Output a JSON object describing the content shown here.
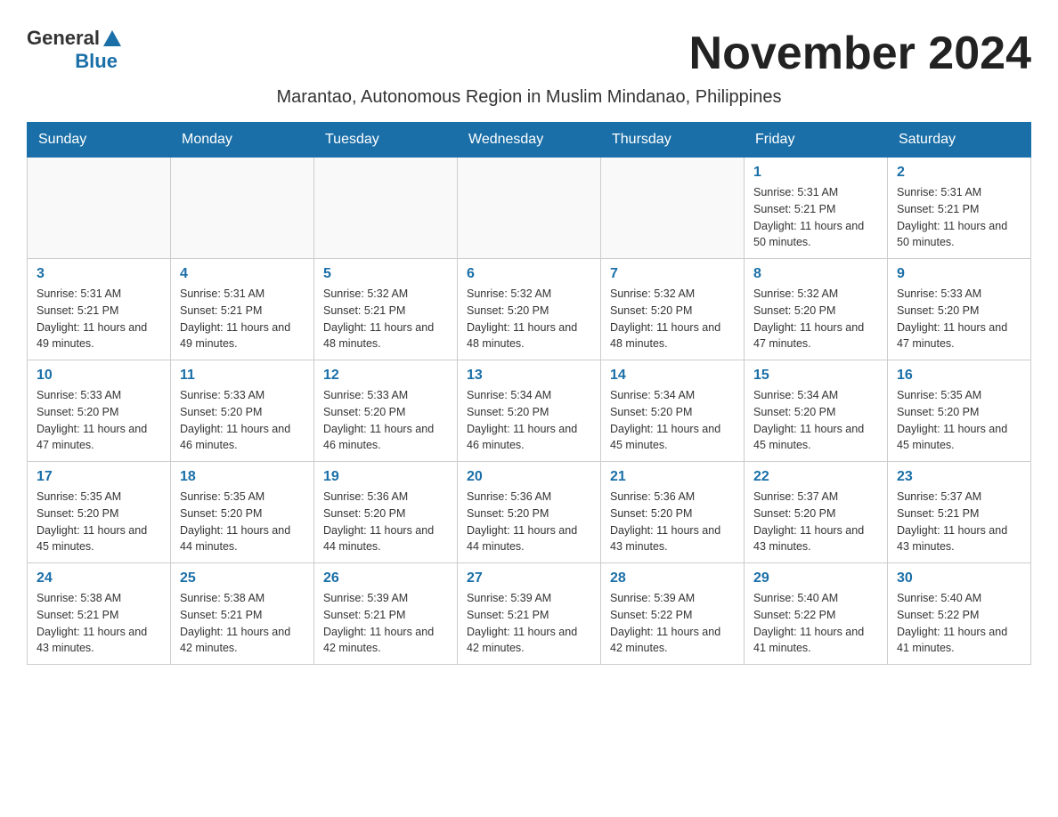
{
  "logo": {
    "general": "General",
    "blue": "Blue"
  },
  "title": "November 2024",
  "subtitle": "Marantao, Autonomous Region in Muslim Mindanao, Philippines",
  "days_of_week": [
    "Sunday",
    "Monday",
    "Tuesday",
    "Wednesday",
    "Thursday",
    "Friday",
    "Saturday"
  ],
  "weeks": [
    [
      {
        "day": "",
        "info": ""
      },
      {
        "day": "",
        "info": ""
      },
      {
        "day": "",
        "info": ""
      },
      {
        "day": "",
        "info": ""
      },
      {
        "day": "",
        "info": ""
      },
      {
        "day": "1",
        "info": "Sunrise: 5:31 AM\nSunset: 5:21 PM\nDaylight: 11 hours and 50 minutes."
      },
      {
        "day": "2",
        "info": "Sunrise: 5:31 AM\nSunset: 5:21 PM\nDaylight: 11 hours and 50 minutes."
      }
    ],
    [
      {
        "day": "3",
        "info": "Sunrise: 5:31 AM\nSunset: 5:21 PM\nDaylight: 11 hours and 49 minutes."
      },
      {
        "day": "4",
        "info": "Sunrise: 5:31 AM\nSunset: 5:21 PM\nDaylight: 11 hours and 49 minutes."
      },
      {
        "day": "5",
        "info": "Sunrise: 5:32 AM\nSunset: 5:21 PM\nDaylight: 11 hours and 48 minutes."
      },
      {
        "day": "6",
        "info": "Sunrise: 5:32 AM\nSunset: 5:20 PM\nDaylight: 11 hours and 48 minutes."
      },
      {
        "day": "7",
        "info": "Sunrise: 5:32 AM\nSunset: 5:20 PM\nDaylight: 11 hours and 48 minutes."
      },
      {
        "day": "8",
        "info": "Sunrise: 5:32 AM\nSunset: 5:20 PM\nDaylight: 11 hours and 47 minutes."
      },
      {
        "day": "9",
        "info": "Sunrise: 5:33 AM\nSunset: 5:20 PM\nDaylight: 11 hours and 47 minutes."
      }
    ],
    [
      {
        "day": "10",
        "info": "Sunrise: 5:33 AM\nSunset: 5:20 PM\nDaylight: 11 hours and 47 minutes."
      },
      {
        "day": "11",
        "info": "Sunrise: 5:33 AM\nSunset: 5:20 PM\nDaylight: 11 hours and 46 minutes."
      },
      {
        "day": "12",
        "info": "Sunrise: 5:33 AM\nSunset: 5:20 PM\nDaylight: 11 hours and 46 minutes."
      },
      {
        "day": "13",
        "info": "Sunrise: 5:34 AM\nSunset: 5:20 PM\nDaylight: 11 hours and 46 minutes."
      },
      {
        "day": "14",
        "info": "Sunrise: 5:34 AM\nSunset: 5:20 PM\nDaylight: 11 hours and 45 minutes."
      },
      {
        "day": "15",
        "info": "Sunrise: 5:34 AM\nSunset: 5:20 PM\nDaylight: 11 hours and 45 minutes."
      },
      {
        "day": "16",
        "info": "Sunrise: 5:35 AM\nSunset: 5:20 PM\nDaylight: 11 hours and 45 minutes."
      }
    ],
    [
      {
        "day": "17",
        "info": "Sunrise: 5:35 AM\nSunset: 5:20 PM\nDaylight: 11 hours and 45 minutes."
      },
      {
        "day": "18",
        "info": "Sunrise: 5:35 AM\nSunset: 5:20 PM\nDaylight: 11 hours and 44 minutes."
      },
      {
        "day": "19",
        "info": "Sunrise: 5:36 AM\nSunset: 5:20 PM\nDaylight: 11 hours and 44 minutes."
      },
      {
        "day": "20",
        "info": "Sunrise: 5:36 AM\nSunset: 5:20 PM\nDaylight: 11 hours and 44 minutes."
      },
      {
        "day": "21",
        "info": "Sunrise: 5:36 AM\nSunset: 5:20 PM\nDaylight: 11 hours and 43 minutes."
      },
      {
        "day": "22",
        "info": "Sunrise: 5:37 AM\nSunset: 5:20 PM\nDaylight: 11 hours and 43 minutes."
      },
      {
        "day": "23",
        "info": "Sunrise: 5:37 AM\nSunset: 5:21 PM\nDaylight: 11 hours and 43 minutes."
      }
    ],
    [
      {
        "day": "24",
        "info": "Sunrise: 5:38 AM\nSunset: 5:21 PM\nDaylight: 11 hours and 43 minutes."
      },
      {
        "day": "25",
        "info": "Sunrise: 5:38 AM\nSunset: 5:21 PM\nDaylight: 11 hours and 42 minutes."
      },
      {
        "day": "26",
        "info": "Sunrise: 5:39 AM\nSunset: 5:21 PM\nDaylight: 11 hours and 42 minutes."
      },
      {
        "day": "27",
        "info": "Sunrise: 5:39 AM\nSunset: 5:21 PM\nDaylight: 11 hours and 42 minutes."
      },
      {
        "day": "28",
        "info": "Sunrise: 5:39 AM\nSunset: 5:22 PM\nDaylight: 11 hours and 42 minutes."
      },
      {
        "day": "29",
        "info": "Sunrise: 5:40 AM\nSunset: 5:22 PM\nDaylight: 11 hours and 41 minutes."
      },
      {
        "day": "30",
        "info": "Sunrise: 5:40 AM\nSunset: 5:22 PM\nDaylight: 11 hours and 41 minutes."
      }
    ]
  ]
}
